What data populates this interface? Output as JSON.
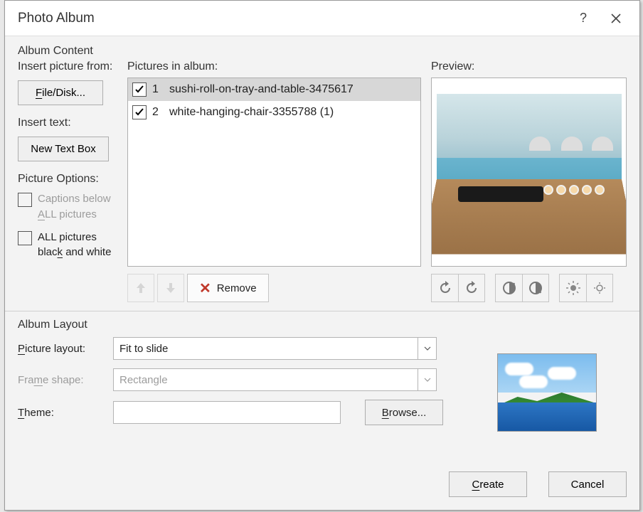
{
  "title": "Photo Album",
  "titlebar": {
    "help": "?",
    "close": "✕"
  },
  "sections": {
    "album_content": "Album Content",
    "album_layout": "Album Layout"
  },
  "insert_picture_label": "Insert picture from:",
  "file_disk_label": "File/Disk...",
  "insert_text_label": "Insert text:",
  "new_text_box_label": "New Text Box",
  "picture_options_label": "Picture Options:",
  "captions_label": "Captions below ALL pictures",
  "bw_label": "ALL pictures black and white",
  "pictures_label": "Pictures in album:",
  "preview_label": "Preview:",
  "pictures": [
    {
      "index": "1",
      "name": "sushi-roll-on-tray-and-table-3475617",
      "checked": true,
      "selected": true
    },
    {
      "index": "2",
      "name": "white-hanging-chair-3355788 (1)",
      "checked": true,
      "selected": false
    }
  ],
  "remove_label": "Remove",
  "layout": {
    "picture_layout_label": "Picture layout:",
    "picture_layout_value": "Fit to slide",
    "frame_shape_label": "Frame shape:",
    "frame_shape_value": "Rectangle",
    "theme_label": "Theme:",
    "theme_value": "",
    "browse_label": "Browse..."
  },
  "footer": {
    "create": "Create",
    "cancel": "Cancel"
  }
}
